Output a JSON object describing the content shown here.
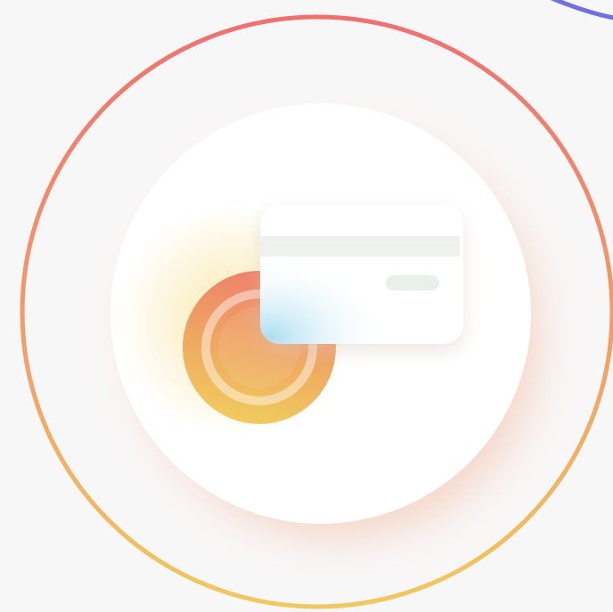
{
  "illustration": {
    "subject": "payment-card-with-coin-icon",
    "colors": {
      "background": "#f8f7f7",
      "ring_gradient_top": "#f07070",
      "ring_gradient_mid": "#f29a6a",
      "ring_gradient_bottom": "#f1c85e",
      "corner_arc": "#6f6fe6",
      "disc": "#ffffff",
      "disc_shadow": "#f4b8a0",
      "coin_top": "#ee7f6a",
      "coin_bottom": "#f0cd5c",
      "card_face": "#ffffff",
      "card_stripe": "#eef1ee",
      "card_chip": "#e9f0ea",
      "card_tint": "#a8dcf0"
    },
    "icons": [
      "ring-icon",
      "coin-icon",
      "credit-card-icon"
    ]
  }
}
